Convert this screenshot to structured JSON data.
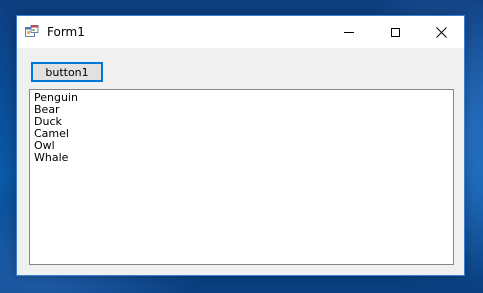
{
  "window": {
    "title": "Form1",
    "icon": "winforms-app-icon",
    "controls": {
      "minimize_icon": "minimize-icon",
      "maximize_icon": "maximize-icon",
      "close_icon": "close-icon"
    }
  },
  "form": {
    "button1_label": "button1",
    "listbox": {
      "items": [
        "Penguin",
        "Bear",
        "Duck",
        "Camel",
        "Owl",
        "Whale"
      ]
    }
  },
  "colors": {
    "accent": "#0078d7",
    "window_bg": "#f0f0f0",
    "desktop": "#0b5aa8"
  }
}
